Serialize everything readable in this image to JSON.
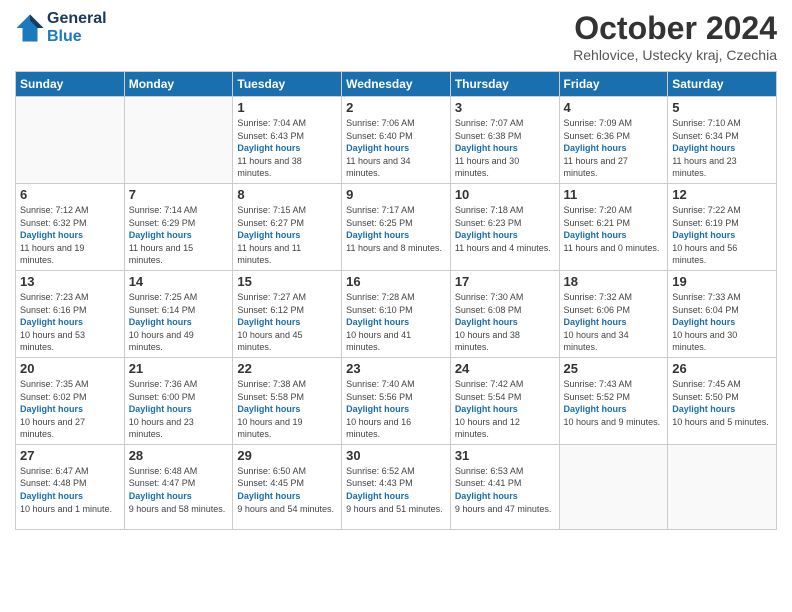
{
  "header": {
    "logo_line1": "General",
    "logo_line2": "Blue",
    "month_title": "October 2024",
    "location": "Rehlovice, Ustecky kraj, Czechia"
  },
  "weekdays": [
    "Sunday",
    "Monday",
    "Tuesday",
    "Wednesday",
    "Thursday",
    "Friday",
    "Saturday"
  ],
  "weeks": [
    [
      {
        "day": "",
        "sunrise": "",
        "sunset": "",
        "daylight": ""
      },
      {
        "day": "",
        "sunrise": "",
        "sunset": "",
        "daylight": ""
      },
      {
        "day": "1",
        "sunrise": "Sunrise: 7:04 AM",
        "sunset": "Sunset: 6:43 PM",
        "daylight": "Daylight: 11 hours and 38 minutes."
      },
      {
        "day": "2",
        "sunrise": "Sunrise: 7:06 AM",
        "sunset": "Sunset: 6:40 PM",
        "daylight": "Daylight: 11 hours and 34 minutes."
      },
      {
        "day": "3",
        "sunrise": "Sunrise: 7:07 AM",
        "sunset": "Sunset: 6:38 PM",
        "daylight": "Daylight: 11 hours and 30 minutes."
      },
      {
        "day": "4",
        "sunrise": "Sunrise: 7:09 AM",
        "sunset": "Sunset: 6:36 PM",
        "daylight": "Daylight: 11 hours and 27 minutes."
      },
      {
        "day": "5",
        "sunrise": "Sunrise: 7:10 AM",
        "sunset": "Sunset: 6:34 PM",
        "daylight": "Daylight: 11 hours and 23 minutes."
      }
    ],
    [
      {
        "day": "6",
        "sunrise": "Sunrise: 7:12 AM",
        "sunset": "Sunset: 6:32 PM",
        "daylight": "Daylight: 11 hours and 19 minutes."
      },
      {
        "day": "7",
        "sunrise": "Sunrise: 7:14 AM",
        "sunset": "Sunset: 6:29 PM",
        "daylight": "Daylight: 11 hours and 15 minutes."
      },
      {
        "day": "8",
        "sunrise": "Sunrise: 7:15 AM",
        "sunset": "Sunset: 6:27 PM",
        "daylight": "Daylight: 11 hours and 11 minutes."
      },
      {
        "day": "9",
        "sunrise": "Sunrise: 7:17 AM",
        "sunset": "Sunset: 6:25 PM",
        "daylight": "Daylight: 11 hours and 8 minutes."
      },
      {
        "day": "10",
        "sunrise": "Sunrise: 7:18 AM",
        "sunset": "Sunset: 6:23 PM",
        "daylight": "Daylight: 11 hours and 4 minutes."
      },
      {
        "day": "11",
        "sunrise": "Sunrise: 7:20 AM",
        "sunset": "Sunset: 6:21 PM",
        "daylight": "Daylight: 11 hours and 0 minutes."
      },
      {
        "day": "12",
        "sunrise": "Sunrise: 7:22 AM",
        "sunset": "Sunset: 6:19 PM",
        "daylight": "Daylight: 10 hours and 56 minutes."
      }
    ],
    [
      {
        "day": "13",
        "sunrise": "Sunrise: 7:23 AM",
        "sunset": "Sunset: 6:16 PM",
        "daylight": "Daylight: 10 hours and 53 minutes."
      },
      {
        "day": "14",
        "sunrise": "Sunrise: 7:25 AM",
        "sunset": "Sunset: 6:14 PM",
        "daylight": "Daylight: 10 hours and 49 minutes."
      },
      {
        "day": "15",
        "sunrise": "Sunrise: 7:27 AM",
        "sunset": "Sunset: 6:12 PM",
        "daylight": "Daylight: 10 hours and 45 minutes."
      },
      {
        "day": "16",
        "sunrise": "Sunrise: 7:28 AM",
        "sunset": "Sunset: 6:10 PM",
        "daylight": "Daylight: 10 hours and 41 minutes."
      },
      {
        "day": "17",
        "sunrise": "Sunrise: 7:30 AM",
        "sunset": "Sunset: 6:08 PM",
        "daylight": "Daylight: 10 hours and 38 minutes."
      },
      {
        "day": "18",
        "sunrise": "Sunrise: 7:32 AM",
        "sunset": "Sunset: 6:06 PM",
        "daylight": "Daylight: 10 hours and 34 minutes."
      },
      {
        "day": "19",
        "sunrise": "Sunrise: 7:33 AM",
        "sunset": "Sunset: 6:04 PM",
        "daylight": "Daylight: 10 hours and 30 minutes."
      }
    ],
    [
      {
        "day": "20",
        "sunrise": "Sunrise: 7:35 AM",
        "sunset": "Sunset: 6:02 PM",
        "daylight": "Daylight: 10 hours and 27 minutes."
      },
      {
        "day": "21",
        "sunrise": "Sunrise: 7:36 AM",
        "sunset": "Sunset: 6:00 PM",
        "daylight": "Daylight: 10 hours and 23 minutes."
      },
      {
        "day": "22",
        "sunrise": "Sunrise: 7:38 AM",
        "sunset": "Sunset: 5:58 PM",
        "daylight": "Daylight: 10 hours and 19 minutes."
      },
      {
        "day": "23",
        "sunrise": "Sunrise: 7:40 AM",
        "sunset": "Sunset: 5:56 PM",
        "daylight": "Daylight: 10 hours and 16 minutes."
      },
      {
        "day": "24",
        "sunrise": "Sunrise: 7:42 AM",
        "sunset": "Sunset: 5:54 PM",
        "daylight": "Daylight: 10 hours and 12 minutes."
      },
      {
        "day": "25",
        "sunrise": "Sunrise: 7:43 AM",
        "sunset": "Sunset: 5:52 PM",
        "daylight": "Daylight: 10 hours and 9 minutes."
      },
      {
        "day": "26",
        "sunrise": "Sunrise: 7:45 AM",
        "sunset": "Sunset: 5:50 PM",
        "daylight": "Daylight: 10 hours and 5 minutes."
      }
    ],
    [
      {
        "day": "27",
        "sunrise": "Sunrise: 6:47 AM",
        "sunset": "Sunset: 4:48 PM",
        "daylight": "Daylight: 10 hours and 1 minute."
      },
      {
        "day": "28",
        "sunrise": "Sunrise: 6:48 AM",
        "sunset": "Sunset: 4:47 PM",
        "daylight": "Daylight: 9 hours and 58 minutes."
      },
      {
        "day": "29",
        "sunrise": "Sunrise: 6:50 AM",
        "sunset": "Sunset: 4:45 PM",
        "daylight": "Daylight: 9 hours and 54 minutes."
      },
      {
        "day": "30",
        "sunrise": "Sunrise: 6:52 AM",
        "sunset": "Sunset: 4:43 PM",
        "daylight": "Daylight: 9 hours and 51 minutes."
      },
      {
        "day": "31",
        "sunrise": "Sunrise: 6:53 AM",
        "sunset": "Sunset: 4:41 PM",
        "daylight": "Daylight: 9 hours and 47 minutes."
      },
      {
        "day": "",
        "sunrise": "",
        "sunset": "",
        "daylight": ""
      },
      {
        "day": "",
        "sunrise": "",
        "sunset": "",
        "daylight": ""
      }
    ]
  ]
}
